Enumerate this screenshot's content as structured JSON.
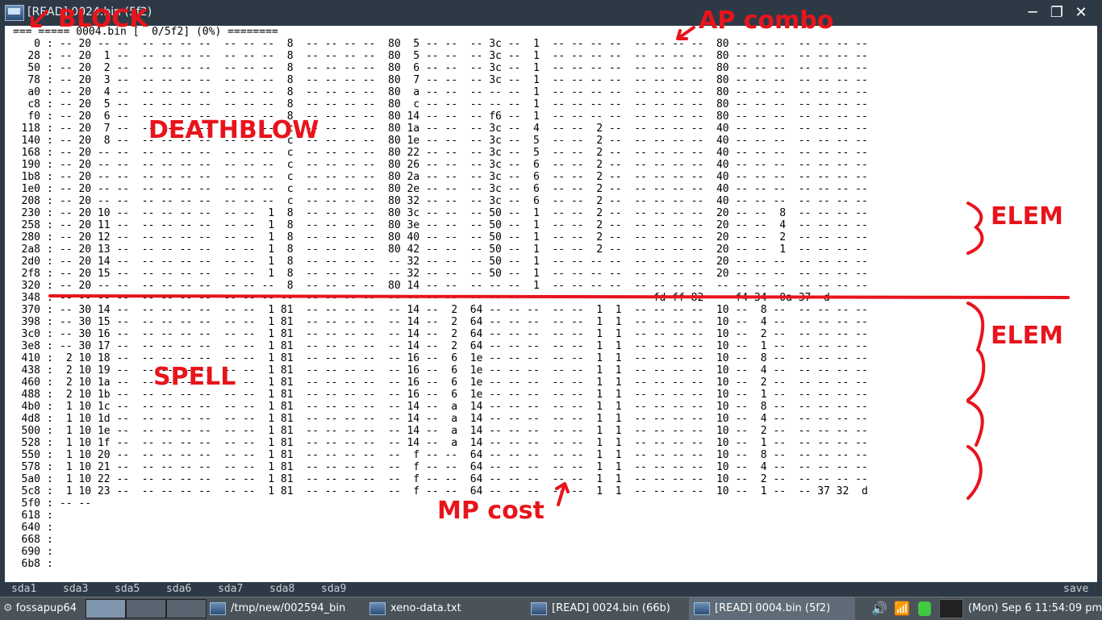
{
  "window": {
    "title": "[READ] 0024.bin (5f2)",
    "minimize_glyph": "─",
    "maximize_glyph": "❐",
    "close_glyph": "✕"
  },
  "terminal": {
    "header_line": "=== ===== 0004.bin [  0/5f2] (0%) ========",
    "rows": [
      {
        "addr": "0",
        "cells": "-- 20 -- --  -- -- -- --  -- -- --  8  -- -- -- --  80  5 -- --  -- 3c --  1  -- -- -- --  -- -- -- --  80 -- -- --  -- -- -- --"
      },
      {
        "addr": "28",
        "cells": "-- 20  1 --  -- -- -- --  -- -- --  8  -- -- -- --  80  5 -- --  -- 3c --  1  -- -- -- --  -- -- -- --  80 -- -- --  -- -- -- --"
      },
      {
        "addr": "50",
        "cells": "-- 20  2 --  -- -- -- --  -- -- --  8  -- -- -- --  80  6 -- --  -- 3c --  1  -- -- -- --  -- -- -- --  80 -- -- --  -- -- -- --"
      },
      {
        "addr": "78",
        "cells": "-- 20  3 --  -- -- -- --  -- -- --  8  -- -- -- --  80  7 -- --  -- 3c --  1  -- -- -- --  -- -- -- --  80 -- -- --  -- -- -- --"
      },
      {
        "addr": "a0",
        "cells": "-- 20  4 --  -- -- -- --  -- -- --  8  -- -- -- --  80  a -- --  -- -- --  1  -- -- -- --  -- -- -- --  80 -- -- --  -- -- -- --"
      },
      {
        "addr": "c8",
        "cells": "-- 20  5 --  -- -- -- --  -- -- --  8  -- -- -- --  80  c -- --  -- -- --  1  -- -- -- --  -- -- -- --  80 -- -- --  -- -- -- --"
      },
      {
        "addr": "f0",
        "cells": "-- 20  6 --  -- -- -- --  -- -- --  8  -- -- -- --  80 14 -- --  -- f6 --  1  -- -- -- --  -- -- -- --  80 -- -- --  -- -- -- --"
      },
      {
        "addr": "118",
        "cells": "-- 20  7 --  -- -- -- --  -- -- --  c  -- -- -- --  80 1a -- --  -- 3c --  4  -- --  2 --  -- -- -- --  40 -- -- --  -- -- -- --"
      },
      {
        "addr": "140",
        "cells": "-- 20  8 --  -- -- -- --  -- -- --  c  -- -- -- --  80 1e -- --  -- 3c --  5  -- --  2 --  -- -- -- --  40 -- -- --  -- -- -- --"
      },
      {
        "addr": "168",
        "cells": "-- 20 -- --  -- -- -- --  -- -- --  c  -- -- -- --  80 22 -- --  -- 3c --  5  -- --  2 --  -- -- -- --  40 -- -- --  -- -- -- --"
      },
      {
        "addr": "190",
        "cells": "-- 20 -- --  -- -- -- --  -- -- --  c  -- -- -- --  80 26 -- --  -- 3c --  6  -- --  2 --  -- -- -- --  40 -- -- --  -- -- -- --"
      },
      {
        "addr": "1b8",
        "cells": "-- 20 -- --  -- -- -- --  -- -- --  c  -- -- -- --  80 2a -- --  -- 3c --  6  -- --  2 --  -- -- -- --  40 -- -- --  -- -- -- --"
      },
      {
        "addr": "1e0",
        "cells": "-- 20 -- --  -- -- -- --  -- -- --  c  -- -- -- --  80 2e -- --  -- 3c --  6  -- --  2 --  -- -- -- --  40 -- -- --  -- -- -- --"
      },
      {
        "addr": "208",
        "cells": "-- 20 -- --  -- -- -- --  -- -- --  c  -- -- -- --  80 32 -- --  -- 3c --  6  -- --  2 --  -- -- -- --  40 -- -- --  -- -- -- --"
      },
      {
        "addr": "230",
        "cells": "-- 20 10 --  -- -- -- --  -- --  1  8  -- -- -- --  80 3c -- --  -- 50 --  1  -- --  2 --  -- -- -- --  20 -- --  8  -- -- -- --"
      },
      {
        "addr": "258",
        "cells": "-- 20 11 --  -- -- -- --  -- --  1  8  -- -- -- --  80 3e -- --  -- 50 --  1  -- --  2 --  -- -- -- --  20 -- --  4  -- -- -- --"
      },
      {
        "addr": "280",
        "cells": "-- 20 12 --  -- -- -- --  -- --  1  8  -- -- -- --  80 40 -- --  -- 50 --  1  -- --  2 --  -- -- -- --  20 -- --  2  -- -- -- --"
      },
      {
        "addr": "2a8",
        "cells": "-- 20 13 --  -- -- -- --  -- --  1  8  -- -- -- --  80 42 -- --  -- 50 --  1  -- --  2 --  -- -- -- --  20 -- --  1  -- -- -- --"
      },
      {
        "addr": "2d0",
        "cells": "-- 20 14 --  -- -- -- --  -- --  1  8  -- -- -- --  -- 32 -- --  -- 50 --  1  -- -- -- --  -- -- -- --  20 -- -- --  -- -- -- --"
      },
      {
        "addr": "2f8",
        "cells": "-- 20 15 --  -- -- -- --  -- --  1  8  -- -- -- --  -- 32 -- --  -- 50 --  1  -- -- -- --  -- -- -- --  20 -- -- --  -- -- -- --"
      },
      {
        "addr": "320",
        "cells": "-- 20 -- --  -- -- -- --  -- -- --  8  -- -- -- --  80 14 -- --  -- -- --  1  -- -- -- --  -- -- -- --  -- -- -- --  -- -- -- --"
      },
      {
        "addr": "348",
        "cells": "-- -- -- --  -- -- -- --  -- -- -- --  -- -- -- --  -- -- -- --  -- -- -- --  -- -- -- --  -- fd ff 82  -- f4 34  0a 37  d"
      },
      {
        "addr": "370",
        "cells": "-- 30 14 --  -- -- -- --  -- --  1 81  -- -- -- --  -- 14 --  2  64 -- -- --  -- --  1  1  -- -- -- --  10 --  8 --  -- -- -- --"
      },
      {
        "addr": "398",
        "cells": "-- 30 15 --  -- -- -- --  -- --  1 81  -- -- -- --  -- 14 --  2  64 -- -- --  -- --  1  1  -- -- -- --  10 --  4 --  -- -- -- --"
      },
      {
        "addr": "3c0",
        "cells": "-- 30 16 --  -- -- -- --  -- --  1 81  -- -- -- --  -- 14 --  2  64 -- -- --  -- --  1  1  -- -- -- --  10 --  2 --  -- -- -- --"
      },
      {
        "addr": "3e8",
        "cells": "-- 30 17 --  -- -- -- --  -- --  1 81  -- -- -- --  -- 14 --  2  64 -- -- --  -- --  1  1  -- -- -- --  10 --  1 --  -- -- -- --"
      },
      {
        "addr": "410",
        "cells": " 2 10 18 --  -- -- -- --  -- --  1 81  -- -- -- --  -- 16 --  6  1e -- -- --  -- --  1  1  -- -- -- --  10 --  8 --  -- -- -- --"
      },
      {
        "addr": "438",
        "cells": " 2 10 19 --  -- -- -- --  -- --  1 81  -- -- -- --  -- 16 --  6  1e -- -- --  -- --  1  1  -- -- -- --  10 --  4 --  -- -- -- --"
      },
      {
        "addr": "460",
        "cells": " 2 10 1a --  -- -- -- --  -- --  1 81  -- -- -- --  -- 16 --  6  1e -- -- --  -- --  1  1  -- -- -- --  10 --  2 --  -- -- -- --"
      },
      {
        "addr": "488",
        "cells": " 2 10 1b --  -- -- -- --  -- --  1 81  -- -- -- --  -- 16 --  6  1e -- -- --  -- --  1  1  -- -- -- --  10 --  1 --  -- -- -- --"
      },
      {
        "addr": "4b0",
        "cells": " 1 10 1c --  -- -- -- --  -- --  1 81  -- -- -- --  -- 14 --  a  14 -- -- --  -- --  1  1  -- -- -- --  10 --  8 --  -- -- -- --"
      },
      {
        "addr": "4d8",
        "cells": " 1 10 1d --  -- -- -- --  -- --  1 81  -- -- -- --  -- 14 --  a  14 -- -- --  -- --  1  1  -- -- -- --  10 --  4 --  -- -- -- --"
      },
      {
        "addr": "500",
        "cells": " 1 10 1e --  -- -- -- --  -- --  1 81  -- -- -- --  -- 14 --  a  14 -- -- --  -- --  1  1  -- -- -- --  10 --  2 --  -- -- -- --"
      },
      {
        "addr": "528",
        "cells": " 1 10 1f --  -- -- -- --  -- --  1 81  -- -- -- --  -- 14 --  a  14 -- -- --  -- --  1  1  -- -- -- --  10 --  1 --  -- -- -- --"
      },
      {
        "addr": "550",
        "cells": " 1 10 20 --  -- -- -- --  -- --  1 81  -- -- -- --  --  f -- --  64 -- -- --  -- --  1  1  -- -- -- --  10 --  8 --  -- -- -- --"
      },
      {
        "addr": "578",
        "cells": " 1 10 21 --  -- -- -- --  -- --  1 81  -- -- -- --  --  f -- --  64 -- -- --  -- --  1  1  -- -- -- --  10 --  4 --  -- -- -- --"
      },
      {
        "addr": "5a0",
        "cells": " 1 10 22 --  -- -- -- --  -- --  1 81  -- -- -- --  --  f -- --  64 -- -- --  -- --  1  1  -- -- -- --  10 --  2 --  -- -- -- --"
      },
      {
        "addr": "5c8",
        "cells": " 1 10 23 --  -- -- -- --  -- --  1 81  -- -- -- --  --  f -- --  64 -- -- --  -- --  1  1  -- -- -- --  10 --  1 --  -- 37 32  d"
      },
      {
        "addr": "5f0",
        "cells": "-- --"
      },
      {
        "addr": "618",
        "cells": ""
      },
      {
        "addr": "640",
        "cells": ""
      },
      {
        "addr": "668",
        "cells": ""
      },
      {
        "addr": "690",
        "cells": ""
      },
      {
        "addr": "6b8",
        "cells": ""
      }
    ]
  },
  "annotations": {
    "block": "BLOCK",
    "ap_combo": "AP combo",
    "deathblow": "DEATHBLOW",
    "elem_top": "ELEM",
    "elem_bottom": "ELEM",
    "spell": "SPELL",
    "mp_cost": "MP cost",
    "color": "#e8141c"
  },
  "fkeys": [
    "sda1",
    "sda3",
    "sda5",
    "sda6",
    "sda7",
    "sda8",
    "sda9",
    "save"
  ],
  "taskbar": {
    "start_label": "fossapup64",
    "tasks": [
      {
        "label": "/tmp/new/002594_bin",
        "icon": "folder-icon"
      },
      {
        "label": "xeno-data.txt",
        "icon": "terminal-icon"
      },
      {
        "label": "[READ] 0024.bin (66b)",
        "icon": "terminal-icon"
      },
      {
        "label": "[READ] 0004.bin (5f2)",
        "icon": "terminal-icon"
      }
    ],
    "clock": "(Mon) Sep 6 11:54:09 pm"
  }
}
